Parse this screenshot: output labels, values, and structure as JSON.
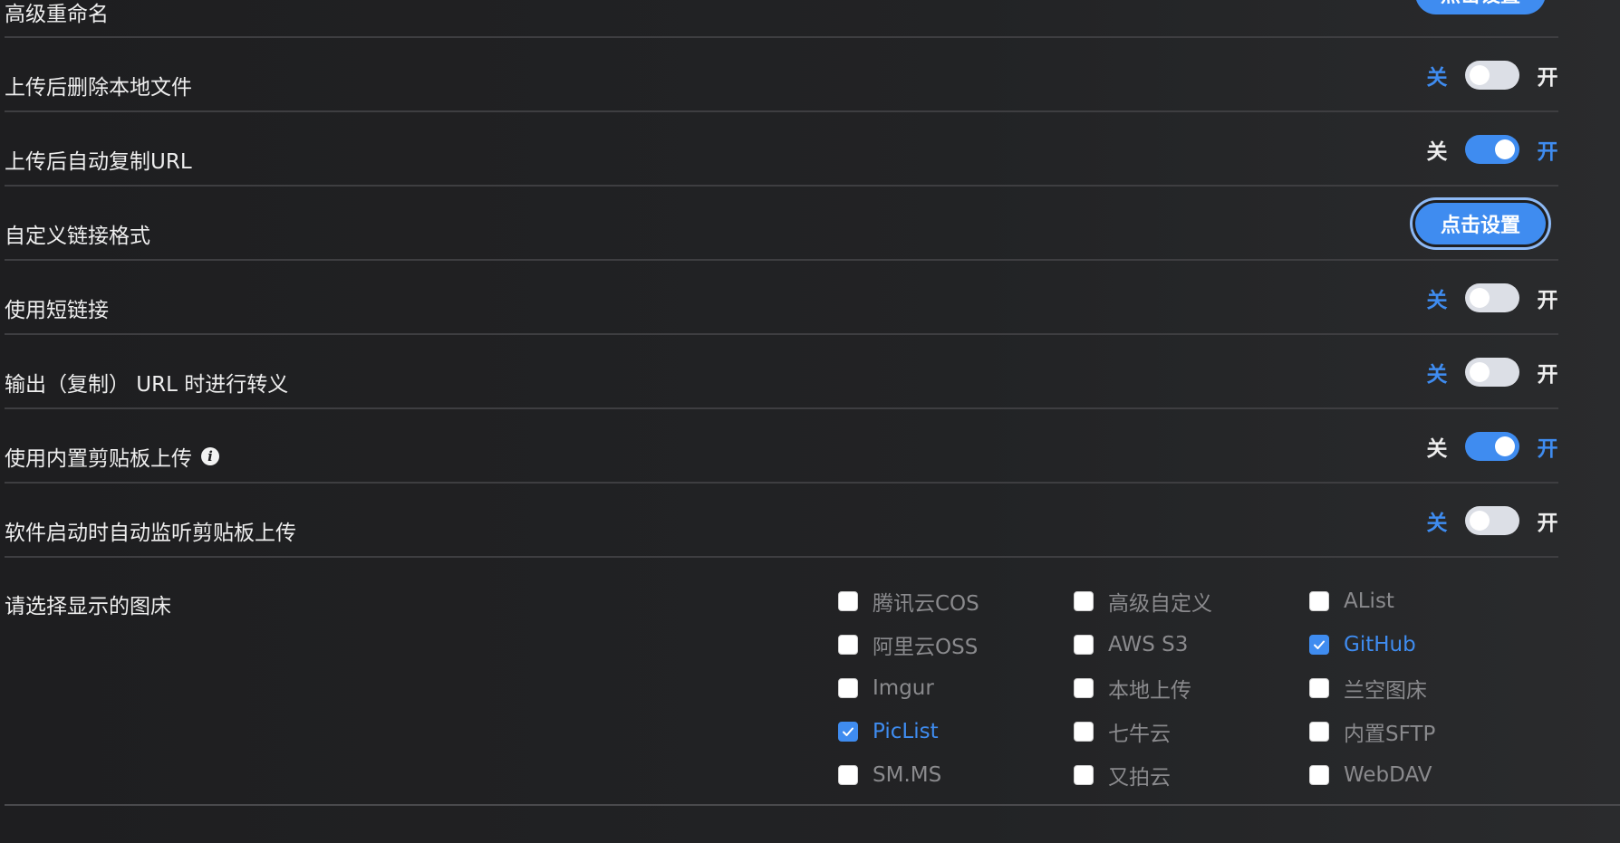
{
  "settings": {
    "advanced_rename": {
      "label": "高级重命名",
      "button": "点击设置"
    },
    "delete_local": {
      "label": "上传后删除本地文件",
      "off": "关",
      "on": "开",
      "state": false
    },
    "auto_copy_url": {
      "label": "上传后自动复制URL",
      "off": "关",
      "on": "开",
      "state": true
    },
    "custom_link": {
      "label": "自定义链接格式",
      "button": "点击设置"
    },
    "short_link": {
      "label": "使用短链接",
      "off": "关",
      "on": "开",
      "state": false
    },
    "escape_url": {
      "label": "输出（复制） URL 时进行转义",
      "off": "关",
      "on": "开",
      "state": false
    },
    "builtin_clipboard": {
      "label": "使用内置剪贴板上传",
      "info_icon": "i",
      "off": "关",
      "on": "开",
      "state": true
    },
    "autostart_clipboard": {
      "label": "软件启动时自动监听剪贴板上传",
      "off": "关",
      "on": "开",
      "state": false
    }
  },
  "hosts": {
    "label": "请选择显示的图床",
    "items": [
      {
        "label": "腾讯云COS",
        "checked": false
      },
      {
        "label": "高级自定义",
        "checked": false
      },
      {
        "label": "AList",
        "checked": false
      },
      {
        "label": "阿里云OSS",
        "checked": false
      },
      {
        "label": "AWS S3",
        "checked": false
      },
      {
        "label": "GitHub",
        "checked": true
      },
      {
        "label": "Imgur",
        "checked": false
      },
      {
        "label": "本地上传",
        "checked": false
      },
      {
        "label": "兰空图床",
        "checked": false
      },
      {
        "label": "PicList",
        "checked": true
      },
      {
        "label": "七牛云",
        "checked": false
      },
      {
        "label": "内置SFTP",
        "checked": false
      },
      {
        "label": "SM.MS",
        "checked": false
      },
      {
        "label": "又拍云",
        "checked": false
      },
      {
        "label": "WebDAV",
        "checked": false
      }
    ]
  },
  "colors": {
    "accent": "#3f8cf0",
    "background": "#1f1f21",
    "divider": "#3e3e41",
    "muted_text": "#8a8a8d"
  }
}
